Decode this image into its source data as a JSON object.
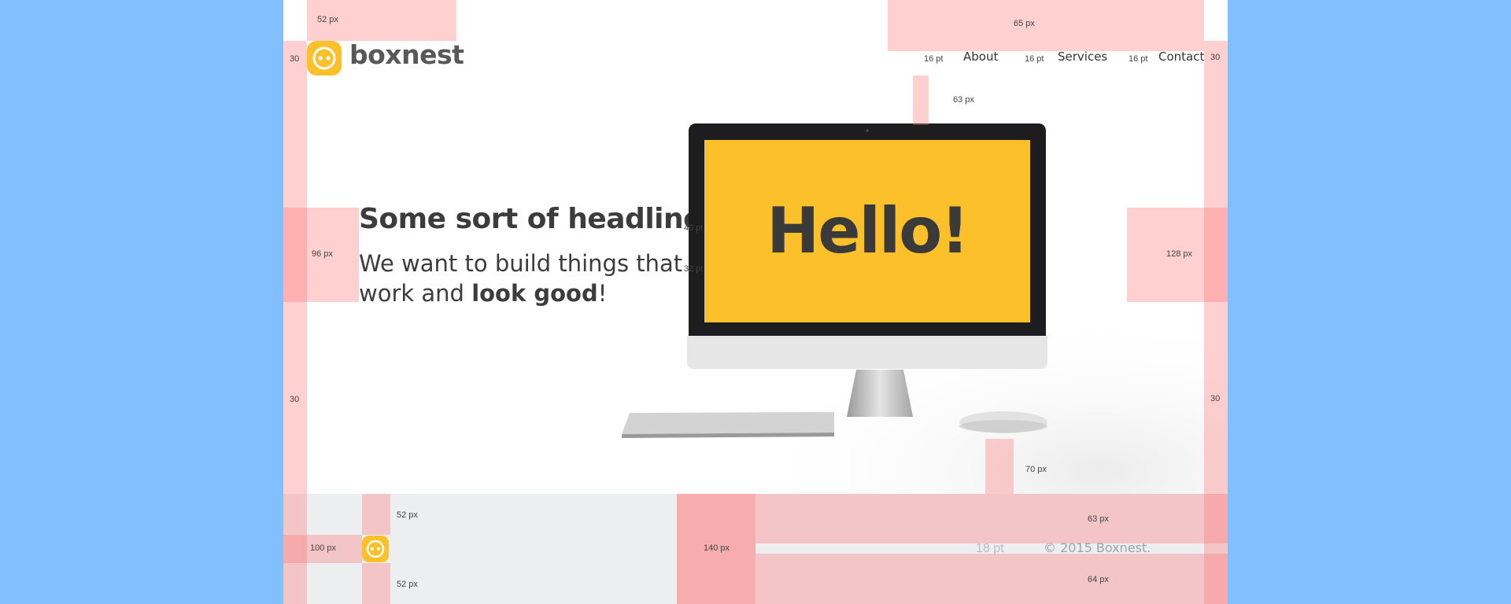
{
  "brand": {
    "name": "boxnest"
  },
  "nav": {
    "items": [
      {
        "label": "About"
      },
      {
        "label": "Services"
      },
      {
        "label": "Contact"
      }
    ]
  },
  "hero": {
    "headline": "Some sort of headline!",
    "subtitle_part1": "We want to build things that work and ",
    "subtitle_bold": "look good",
    "subtitle_end": "!",
    "screen_text": "Hello!"
  },
  "footer": {
    "copyright": "© 2015 Boxnest."
  },
  "annotations": {
    "logo_top": "52 px",
    "nav_top": "65 px",
    "side_left": "30",
    "side_right": "30",
    "nav_gap_1": "16 pt",
    "nav_gap_2": "16 pt",
    "nav_gap_3": "16 pt",
    "monitor_top": "63 px",
    "hero_left": "96 px",
    "headline_size": "40 pt",
    "subtitle_size": "32 pt",
    "hero_right": "128 px",
    "side_left_mid": "30",
    "side_right_mid": "30",
    "hero_bottom": "70 px",
    "footer_logo_top": "52 px",
    "footer_logo_bottom": "52 px",
    "footer_left": "100 px",
    "footer_gap": "140 px",
    "footer_text_top": "63 px",
    "footer_text_size": "18 pt",
    "footer_text_bottom": "64 px"
  },
  "colors": {
    "background": "#82bffe",
    "accent": "#fcc02a",
    "text": "#3c3c3c",
    "footer_bg": "#edeef0"
  }
}
